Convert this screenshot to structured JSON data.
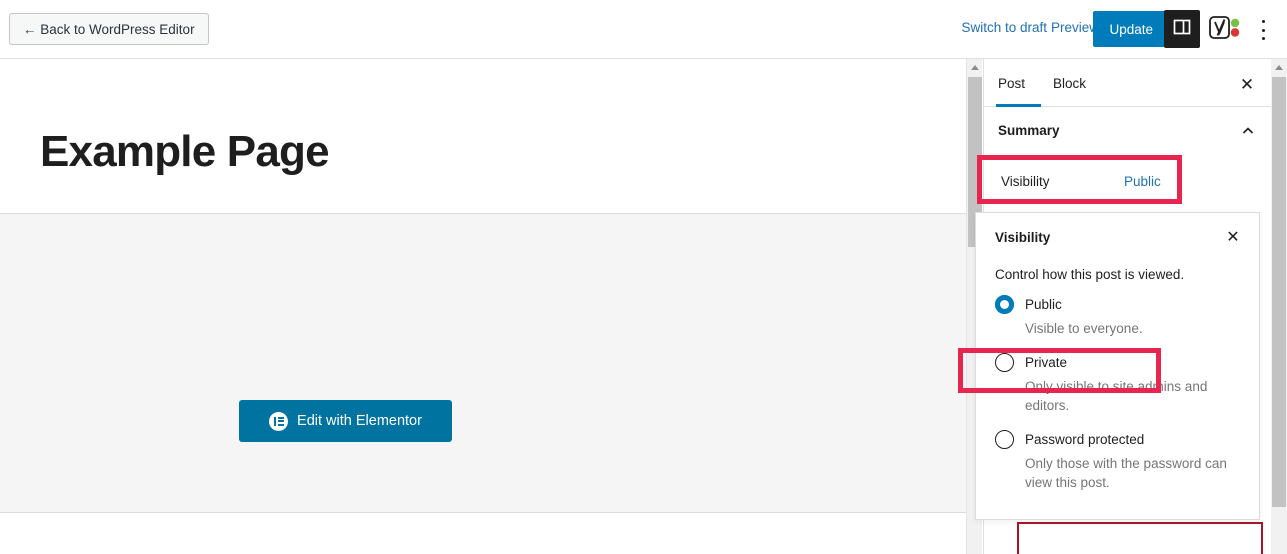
{
  "topbar": {
    "back_label": "← Back to WordPress Editor",
    "switch_to_draft": "Switch to draft",
    "preview": "Preview",
    "update": "Update",
    "sidebar_toggle_icon": "sidebar-panel-icon",
    "yoast_icon": "yoast-seo-icon",
    "kebab_icon": "more-options-icon"
  },
  "editor": {
    "post_title": "Example Page",
    "elementor_button": "Edit with Elementor",
    "elementor_icon": "elementor-logo-icon"
  },
  "sidebar": {
    "tabs": [
      {
        "label": "Post",
        "active": true
      },
      {
        "label": "Block",
        "active": false
      }
    ],
    "close_icon": "close-icon",
    "summary": {
      "label": "Summary",
      "chevron_icon": "chevron-up-icon"
    },
    "visibility_row": {
      "label": "Visibility",
      "value": "Public"
    }
  },
  "popover": {
    "title": "Visibility",
    "close_icon": "close-icon",
    "description": "Control how this post is viewed.",
    "options": [
      {
        "label": "Public",
        "description": "Visible to everyone.",
        "selected": true
      },
      {
        "label": "Private",
        "description": "Only visible to site admins and editors.",
        "selected": false
      },
      {
        "label": "Password protected",
        "description": "Only those with the password can view this post.",
        "selected": false
      }
    ]
  },
  "colors": {
    "accent_blue": "#007cba",
    "link_blue": "#2271b1",
    "annotation_red": "#e8254f",
    "elementor_blue": "#0073a0",
    "yoast_green": "#7ac143",
    "yoast_red": "#dc3232"
  }
}
